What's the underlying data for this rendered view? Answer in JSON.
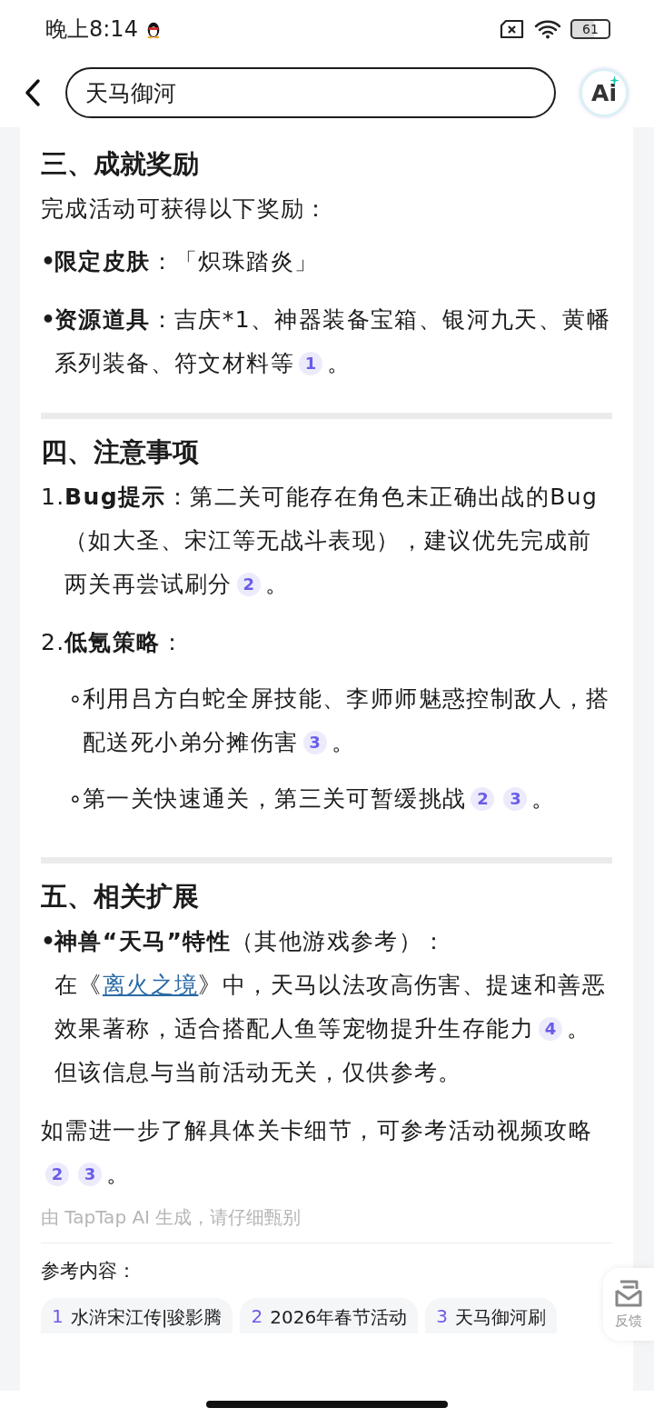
{
  "status_bar": {
    "time": "晚上8:14",
    "battery": "61"
  },
  "header": {
    "search_value": "天马御河",
    "ai_label": "Ai"
  },
  "sections": [
    {
      "heading": "三、成就奖励",
      "blocks": [
        {
          "kind": "para",
          "paragraphs": [
            {
              "segments": [
                {
                  "kind": "text",
                  "text": "完成活动可获得以下奖励："
                }
              ]
            }
          ]
        },
        {
          "kind": "bullet",
          "marker": "•",
          "paragraphs": [
            {
              "segments": [
                {
                  "kind": "bold",
                  "text": "限定皮肤"
                },
                {
                  "kind": "text",
                  "text": "：「炽珠踏炎」"
                }
              ]
            }
          ]
        },
        {
          "kind": "bullet",
          "marker": "•",
          "paragraphs": [
            {
              "segments": [
                {
                  "kind": "bold",
                  "text": "资源道具"
                },
                {
                  "kind": "text",
                  "text": "：吉庆*1、神器装备宝箱、银河九天、黄幡系列装备、符文材料等"
                },
                {
                  "kind": "cite",
                  "text": "1"
                },
                {
                  "kind": "text",
                  "text": "。"
                }
              ]
            }
          ]
        }
      ]
    },
    {
      "heading": "四、注意事项",
      "blocks": [
        {
          "kind": "numbered",
          "marker": "1.",
          "paragraphs": [
            {
              "segments": [
                {
                  "kind": "bold",
                  "text": "Bug提示"
                },
                {
                  "kind": "text",
                  "text": "：第二关可能存在角色未正确出战的Bug（如大圣、宋江等无战斗表现），建议优先完成前两关再尝试刷分"
                },
                {
                  "kind": "cite",
                  "text": "2"
                },
                {
                  "kind": "text",
                  "text": "。"
                }
              ]
            }
          ]
        },
        {
          "kind": "numbered",
          "marker": "2.",
          "paragraphs": [
            {
              "segments": [
                {
                  "kind": "bold",
                  "text": "低氪策略"
                },
                {
                  "kind": "text",
                  "text": "："
                }
              ]
            }
          ],
          "children": [
            {
              "kind": "subbullet",
              "marker": "∘",
              "paragraphs": [
                {
                  "segments": [
                    {
                      "kind": "text",
                      "text": "利用吕方白蛇全屏技能、李师师魅惑控制敌人，搭配送死小弟分摊伤害"
                    },
                    {
                      "kind": "cite",
                      "text": "3"
                    },
                    {
                      "kind": "text",
                      "text": "。"
                    }
                  ]
                }
              ]
            },
            {
              "kind": "subbullet",
              "marker": "∘",
              "paragraphs": [
                {
                  "segments": [
                    {
                      "kind": "text",
                      "text": "第一关快速通关，第三关可暂缓挑战"
                    },
                    {
                      "kind": "cite",
                      "text": "2"
                    },
                    {
                      "kind": "cite",
                      "text": "3"
                    },
                    {
                      "kind": "text",
                      "text": "。"
                    }
                  ]
                }
              ]
            }
          ]
        }
      ]
    },
    {
      "heading": "五、相关扩展",
      "blocks": [
        {
          "kind": "bullet",
          "marker": "•",
          "paragraphs": [
            {
              "segments": [
                {
                  "kind": "bold",
                  "text": "神兽“天马”特性"
                },
                {
                  "kind": "text",
                  "text": "（其他游戏参考）："
                }
              ]
            },
            {
              "segments": [
                {
                  "kind": "text",
                  "text": "在《"
                },
                {
                  "kind": "link",
                  "text": "离火之境"
                },
                {
                  "kind": "text",
                  "text": "》中，天马以法攻高伤害、提速和善恶效果著称，适合搭配人鱼等宠物提升生存能力"
                },
                {
                  "kind": "cite",
                  "text": "4"
                },
                {
                  "kind": "text",
                  "text": "。但该信息与当前活动无关，仅供参考。"
                }
              ]
            }
          ]
        },
        {
          "kind": "para",
          "paragraphs": [
            {
              "segments": [
                {
                  "kind": "text",
                  "text": "如需进一步了解具体关卡细节，可参考活动视频攻略"
                },
                {
                  "kind": "cite",
                  "text": "2"
                },
                {
                  "kind": "cite",
                  "text": "3"
                },
                {
                  "kind": "text",
                  "text": "。"
                }
              ]
            }
          ]
        }
      ]
    }
  ],
  "disclaimer": "由 TapTap AI 生成，请仔细甄别",
  "references_title": "参考内容：",
  "references": [
    {
      "number": "1",
      "title": "水浒宋江传|骏影腾"
    },
    {
      "number": "2",
      "title": "2026年春节活动"
    },
    {
      "number": "3",
      "title": "天马御河刷"
    }
  ],
  "feedback": {
    "label": "反馈"
  }
}
